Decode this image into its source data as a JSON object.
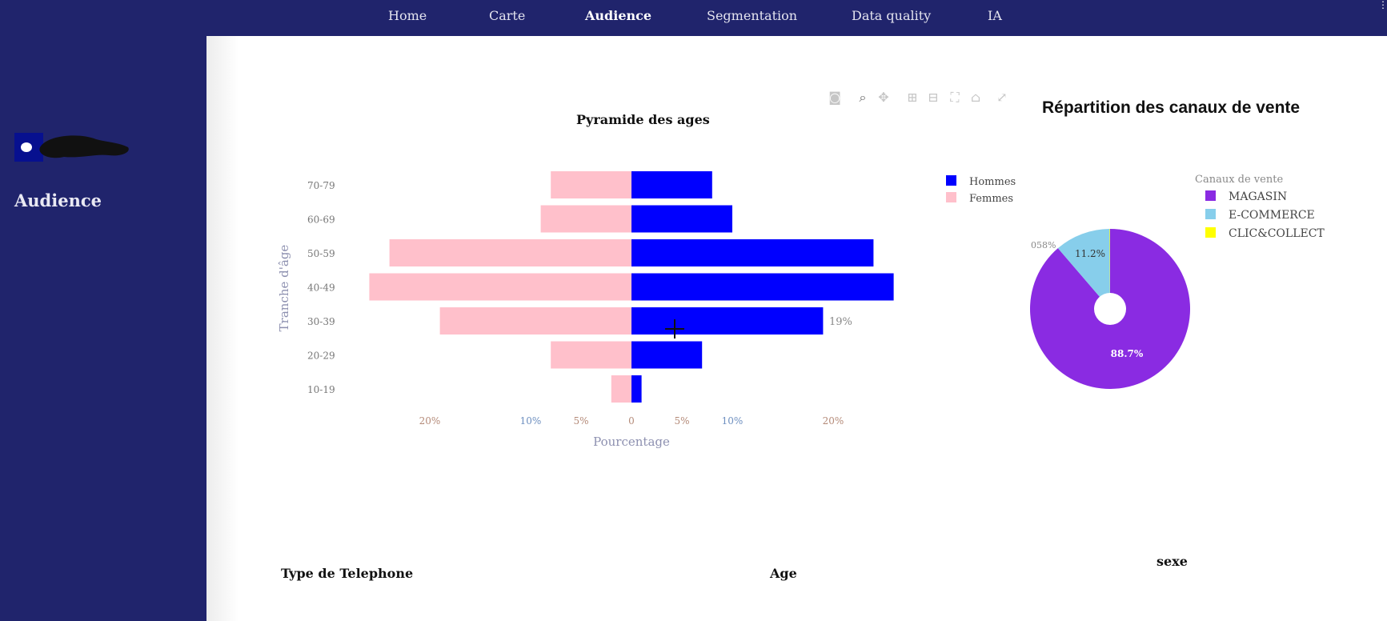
{
  "app": {
    "section_title": "Audience"
  },
  "nav": [
    {
      "label": "Home",
      "active": false
    },
    {
      "label": "Carte",
      "active": false
    },
    {
      "label": "Audience",
      "active": true
    },
    {
      "label": "Segmentation",
      "active": false
    },
    {
      "label": "Data quality",
      "active": false
    },
    {
      "label": "IA",
      "active": false
    }
  ],
  "toolbar_icons": [
    "camera-icon",
    "zoom-icon",
    "pan-icon",
    "zoom-in-icon",
    "zoom-out-icon",
    "autoscale-icon",
    "home-icon",
    "fullscreen-icon"
  ],
  "pyramid": {
    "title": "Pyramide des ages",
    "ylabel": "Tranche d'âge",
    "xlabel": "Pourcentage",
    "legend": [
      "Hommes",
      "Femmes"
    ],
    "bar_label": "19%"
  },
  "pie": {
    "title": "Répartition des canaux de vente",
    "legend_title": "Canaux de vente",
    "legend": [
      "MAGASIN",
      "E-COMMERCE",
      "CLIC&COLLECT"
    ],
    "labels": [
      "88.7%",
      "11.2%",
      "058%"
    ]
  },
  "sections": {
    "phone": "Type de Telephone",
    "age": "Age",
    "sex": "sexe"
  },
  "chart_data": [
    {
      "type": "bar",
      "orientation": "horizontal",
      "title": "Pyramide des ages",
      "xlabel": "Pourcentage",
      "ylabel": "Tranche d'âge",
      "categories": [
        "10-19",
        "20-29",
        "30-39",
        "40-49",
        "50-59",
        "60-69",
        "70-79"
      ],
      "series": [
        {
          "name": "Hommes",
          "color": "#0000ff",
          "values": [
            1,
            7,
            19,
            26,
            24,
            10,
            8
          ]
        },
        {
          "name": "Femmes",
          "color": "#ffc0cb",
          "values": [
            -2,
            -8,
            -19,
            -26,
            -24,
            -9,
            -8
          ]
        }
      ],
      "xticks": [
        {
          "value": -20,
          "label": "20%",
          "color": "#b48a78"
        },
        {
          "value": -10,
          "label": "10%",
          "color": "#6c8ebf"
        },
        {
          "value": -5,
          "label": "5%",
          "color": "#b48a78"
        },
        {
          "value": 0,
          "label": "0",
          "color": "#b48a78"
        },
        {
          "value": 5,
          "label": "5%",
          "color": "#b48a78"
        },
        {
          "value": 10,
          "label": "10%",
          "color": "#6c8ebf"
        },
        {
          "value": 20,
          "label": "20%",
          "color": "#b48a78"
        }
      ],
      "xlim": [
        -26,
        26
      ],
      "legend_position": "top-right"
    },
    {
      "type": "pie",
      "title": "Répartition des canaux de vente",
      "legend_title": "Canaux de vente",
      "slices": [
        {
          "name": "MAGASIN",
          "value": 88.7,
          "color": "#8a2be2"
        },
        {
          "name": "E-COMMERCE",
          "value": 11.2,
          "color": "#87ceeb"
        },
        {
          "name": "CLIC&COLLECT",
          "value": 0.1,
          "color": "#ffff00"
        }
      ],
      "legend_position": "top-right"
    }
  ]
}
